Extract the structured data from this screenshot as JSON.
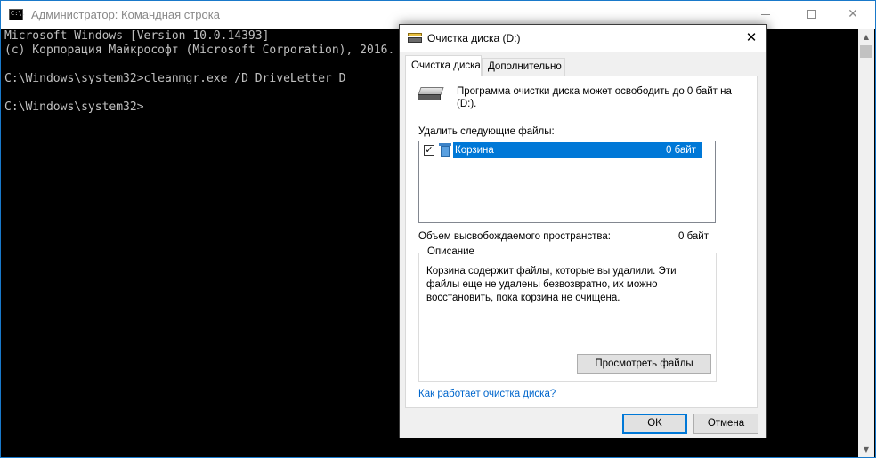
{
  "cmd": {
    "title": "Администратор: Командная строка",
    "icon_label": "C:\\.",
    "lines": [
      "Microsoft Windows [Version 10.0.14393]",
      "(c) Корпорация Майкрософт (Microsoft Corporation), 2016.",
      "",
      "C:\\Windows\\system32>cleanmgr.exe /D DriveLetter D",
      "",
      "C:\\Windows\\system32>"
    ],
    "icons": {
      "minimize": "minimize-icon",
      "maximize": "maximize-icon",
      "close": "close-icon"
    },
    "close_glyph": "✕",
    "scroll_up_glyph": "▲",
    "scroll_down_glyph": "▼"
  },
  "dialog": {
    "title": "Очистка диска  (D:)",
    "close_glyph": "✕",
    "tabs": [
      {
        "label": "Очистка диска",
        "selected": true
      },
      {
        "label": "Дополнительно",
        "selected": false
      }
    ],
    "intro": "Программа очистки диска может освободить до 0 байт на  (D:).",
    "delete_label": "Удалить следующие файлы:",
    "files": [
      {
        "name": "Корзина",
        "size": "0 байт",
        "checked": true,
        "check_glyph": "✓",
        "icon": "recycle-bin-icon"
      }
    ],
    "space_label": "Объем высвобождаемого пространства:",
    "space_value": "0 байт",
    "description_legend": "Описание",
    "description_text": "Корзина содержит файлы, которые вы удалили. Эти файлы еще не удалены безвозвратно, их можно восстановить, пока корзина не очищена.",
    "view_files_label": "Просмотреть файлы",
    "help_link": "Как работает очистка диска?",
    "ok_label": "OK",
    "cancel_label": "Отмена"
  },
  "colors": {
    "selection": "#0078d7",
    "console_bg": "#000000",
    "console_text": "#c0c0c0",
    "link": "#0066cc"
  }
}
